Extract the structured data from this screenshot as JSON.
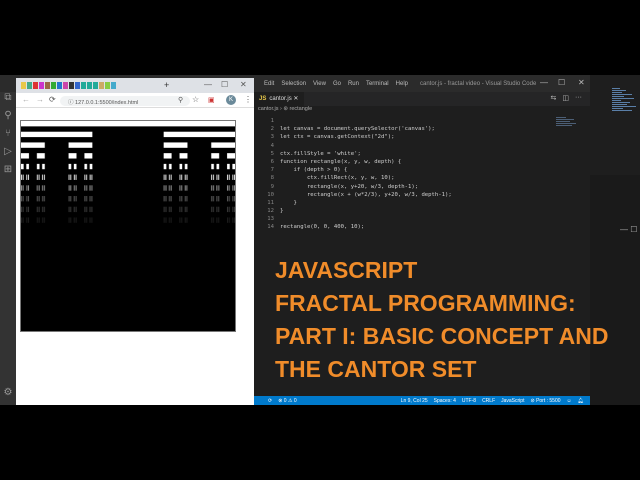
{
  "vscode": {
    "menu": [
      "Edit",
      "Selection",
      "View",
      "Go",
      "Run",
      "Terminal",
      "Help"
    ],
    "window_title": "cantor.js - fractal video - Visual Studio Code",
    "tab_label": "cantor.js",
    "tab_lang": "JS",
    "breadcrumb": [
      "cantor.js",
      "rectangle"
    ],
    "code_lines": [
      "",
      "let canvas = document.querySelector('canvas');",
      "let ctx = canvas.getContext(\"2d\");",
      "",
      "ctx.fillStyle = 'white';",
      "function rectangle(x, y, w, depth) {",
      "    if (depth > 0) {",
      "        ctx.fillRect(x, y, w, 10);",
      "        rectangle(x, y+20, w/3, depth-1);",
      "        rectangle(x + (w*2/3), y+20, w/3, depth-1);",
      "    }",
      "}",
      "",
      "rectangle(0, 0, 400, 10);"
    ],
    "status": {
      "errors": "0",
      "warnings": "0",
      "position": "Ln 9, Col 25",
      "spaces": "Spaces: 4",
      "encoding": "UTF-8",
      "eol": "CRLF",
      "language": "JavaScript",
      "port": "Port : 5500"
    }
  },
  "browser": {
    "url": "127.0.0.1:5500/index.html",
    "profile_initial": "K"
  },
  "fractal": {
    "width": 400,
    "bar_height": 10,
    "row_step": 20,
    "depth": 10
  },
  "headline": [
    "JAVASCRIPT",
    "FRACTAL PROGRAMMING:",
    "PART I: BASIC CONCEPT AND",
    "THE CANTOR SET"
  ],
  "colors": {
    "headline": "#f08c2a",
    "status_bar": "#007acc"
  }
}
